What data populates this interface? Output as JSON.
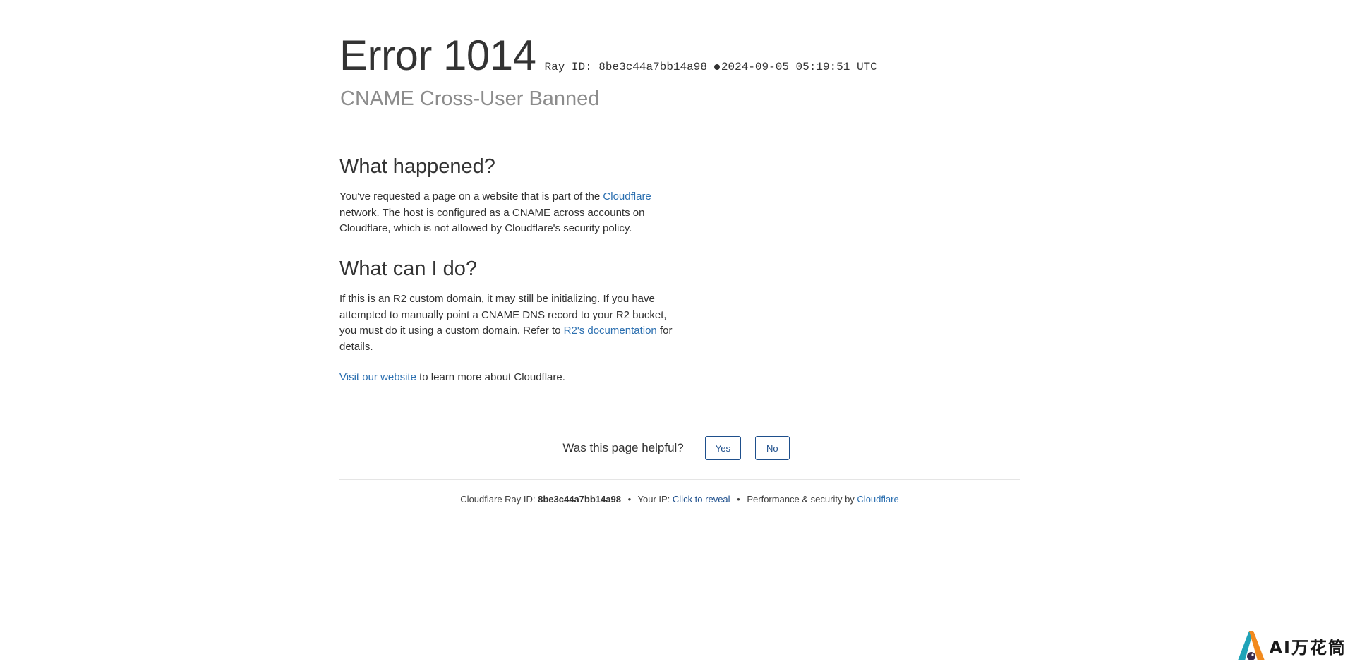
{
  "header": {
    "error_title": "Error 1014",
    "ray_label": "Ray ID: 8be3c44a7bb14a98",
    "timestamp": "2024-09-05 05:19:51 UTC",
    "subtitle": "CNAME Cross-User Banned"
  },
  "what_happened": {
    "heading": "What happened?",
    "text_before_link": "You've requested a page on a website that is part of the ",
    "link": "Cloudflare",
    "text_after_link": " network. The host is configured as a CNAME across accounts on Cloudflare, which is not allowed by Cloudflare's security policy."
  },
  "what_can_i_do": {
    "heading": "What can I do?",
    "text_before_link": "If this is an R2 custom domain, it may still be initializing. If you have attempted to manually point a CNAME DNS record to your R2 bucket, you must do it using a custom domain. Refer to ",
    "link": "R2's documentation",
    "text_after_link": " for details."
  },
  "visit": {
    "link": "Visit our website",
    "text": " to learn more about Cloudflare."
  },
  "feedback": {
    "question": "Was this page helpful?",
    "yes": "Yes",
    "no": "No"
  },
  "footer": {
    "ray_label": "Cloudflare Ray ID: ",
    "ray_id": "8be3c44a7bb14a98",
    "ip_label": "Your IP: ",
    "ip_link": "Click to reveal",
    "perf_label": "Performance & security by ",
    "perf_link": "Cloudflare",
    "separator": "•"
  },
  "watermark": {
    "text": "AI万花筒"
  },
  "colors": {
    "link": "#2b6fb0",
    "button_border": "#1e4f8c",
    "subtitle": "#8c8c8c"
  }
}
